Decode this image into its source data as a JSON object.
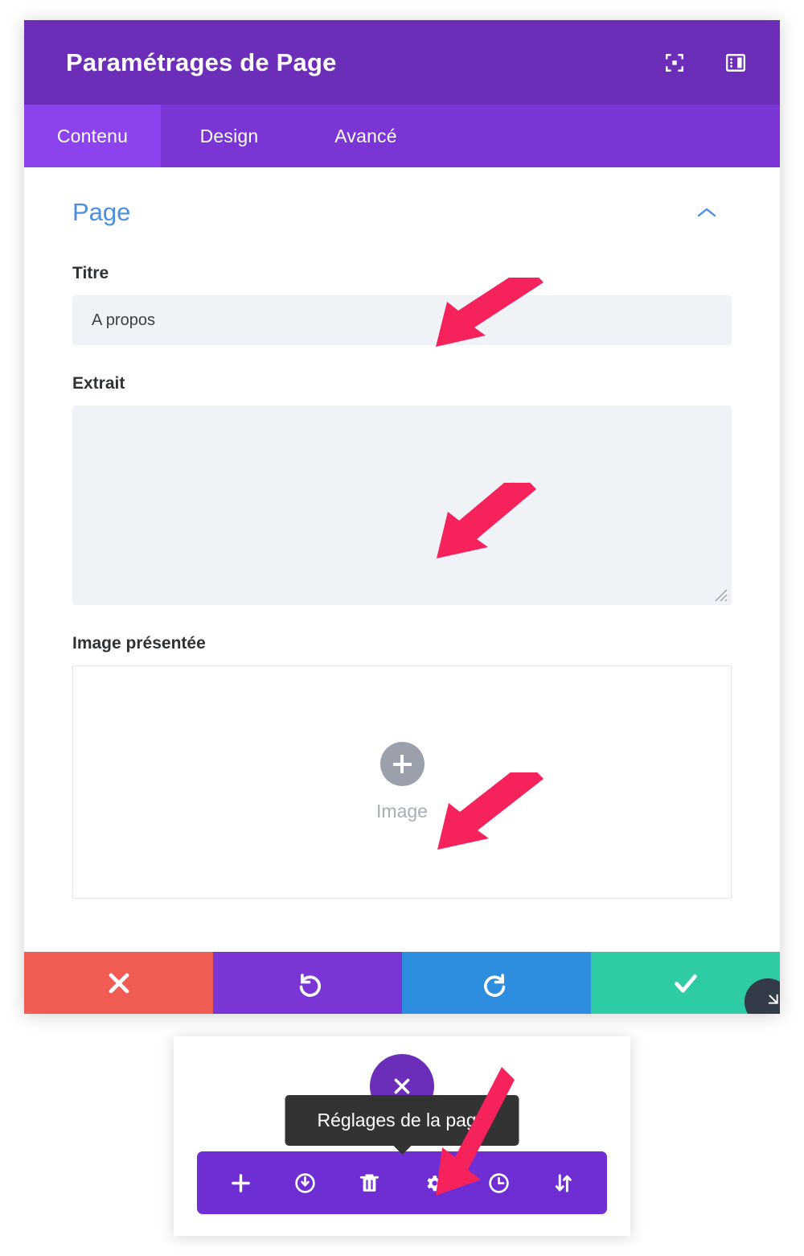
{
  "panel": {
    "header": {
      "title": "Paramétrages de Page",
      "icons": [
        {
          "name": "fullscreen-icon",
          "label": "Plein écran"
        },
        {
          "name": "layout-panel-icon",
          "label": "Disposition du panneau"
        }
      ]
    },
    "tabs": [
      {
        "label": "Contenu",
        "active": true
      },
      {
        "label": "Design",
        "active": false
      },
      {
        "label": "Avancé",
        "active": false
      }
    ],
    "section": {
      "title": "Page",
      "collapse_icon": "chevron-up-icon"
    },
    "fields": {
      "title": {
        "label": "Titre",
        "value": "A propos",
        "placeholder": ""
      },
      "excerpt": {
        "label": "Extrait",
        "value": "",
        "placeholder": ""
      },
      "featured_image": {
        "label": "Image présentée",
        "button_label": "Image",
        "add_icon": "plus-icon"
      }
    },
    "actions": [
      {
        "name": "cancel-button",
        "icon": "close-icon",
        "color": "#F05B53"
      },
      {
        "name": "undo-button",
        "icon": "undo-icon",
        "color": "#7A35D4"
      },
      {
        "name": "redo-button",
        "icon": "redo-icon",
        "color": "#2D8DDE"
      },
      {
        "name": "save-button",
        "icon": "check-icon",
        "color": "#2ECCA4"
      }
    ],
    "resize_handle": "resize-corner-icon"
  },
  "floating_toolbar": {
    "close_icon": "close-icon",
    "tooltip": "Réglages de la page",
    "buttons": [
      {
        "name": "add-section-button",
        "icon": "plus-icon"
      },
      {
        "name": "save-library-button",
        "icon": "power-save-icon"
      },
      {
        "name": "delete-button",
        "icon": "trash-icon"
      },
      {
        "name": "page-settings-button",
        "icon": "gear-icon"
      },
      {
        "name": "history-button",
        "icon": "clock-icon"
      },
      {
        "name": "sort-button",
        "icon": "sort-arrows-icon"
      }
    ]
  },
  "annotations": {
    "arrow_color": "#F5225C",
    "arrows": [
      {
        "name": "arrow-to-title-field"
      },
      {
        "name": "arrow-to-excerpt-field"
      },
      {
        "name": "arrow-to-image-field"
      },
      {
        "name": "arrow-to-gear-button"
      }
    ]
  }
}
